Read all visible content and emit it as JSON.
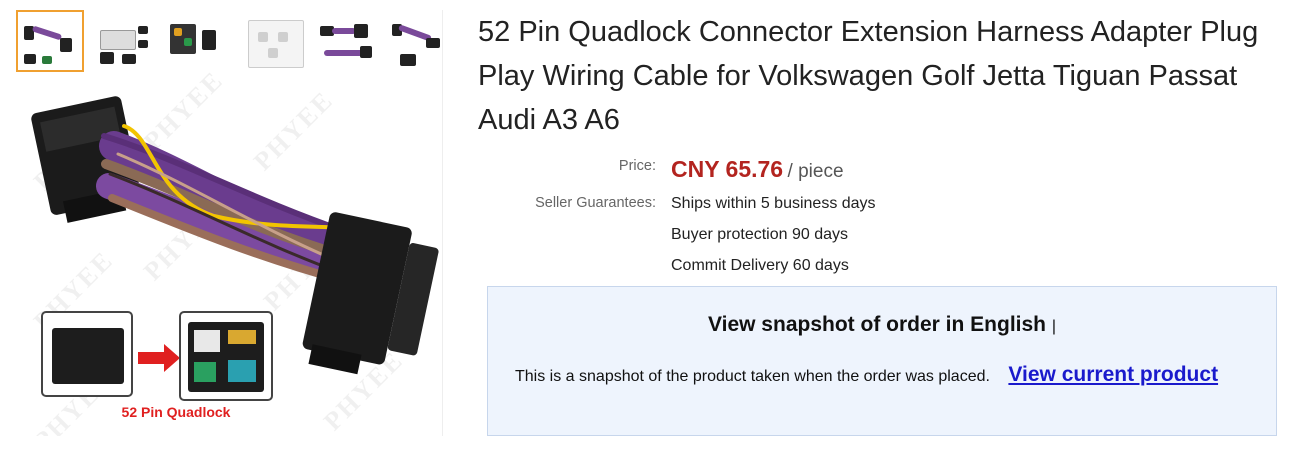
{
  "product": {
    "title": "52 Pin Quadlock Connector Extension Harness Adapter Plug Play Wiring Cable for Volkswagen Golf Jetta Tiguan Passat Audi A3 A6",
    "price_label": "Price:",
    "price_amount": "CNY 65.76",
    "price_unit": "/ piece",
    "guarantees_label": "Seller Guarantees:",
    "guarantees": [
      "Ships within 5 business days",
      "Buyer protection 90 days",
      "Commit Delivery 60 days"
    ]
  },
  "gallery": {
    "watermark": "PHYEE",
    "caption": "52 Pin Quadlock"
  },
  "snapshot": {
    "title": "View snapshot of order in English",
    "separator": "|",
    "text": "This is a snapshot of the product taken when the order was placed.",
    "link_label": "View current product"
  },
  "colors": {
    "price": "#b3241f",
    "link": "#1a1acc",
    "panel_bg": "#eef4fd",
    "thumb_active_border": "#f0a030"
  }
}
